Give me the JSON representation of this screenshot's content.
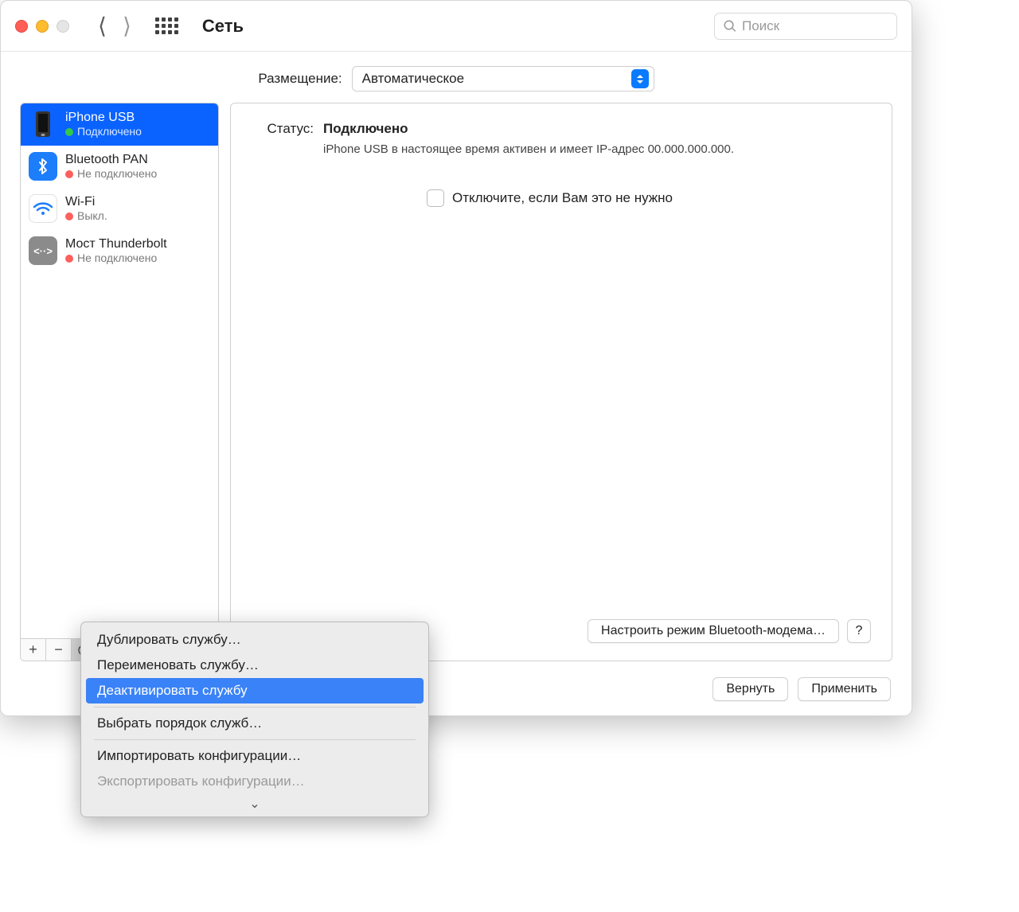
{
  "toolbar": {
    "title": "Сеть",
    "search_placeholder": "Поиск"
  },
  "location": {
    "label": "Размещение:",
    "value": "Автоматическое"
  },
  "sidebar": {
    "services": [
      {
        "name": "iPhone USB",
        "status": "Подключено",
        "dot": "green",
        "icon": "phone",
        "selected": true
      },
      {
        "name": "Bluetooth PAN",
        "status": "Не подключено",
        "dot": "red",
        "icon": "bluetooth",
        "selected": false
      },
      {
        "name": "Wi-Fi",
        "status": "Выкл.",
        "dot": "red",
        "icon": "wifi",
        "selected": false
      },
      {
        "name": "Мост Thunderbolt",
        "status": "Не подключено",
        "dot": "red",
        "icon": "thunderbolt",
        "selected": false
      }
    ]
  },
  "detail": {
    "status_label": "Статус:",
    "status_value": "Подключено",
    "status_desc": "iPhone USB в настоящее время активен и имеет IP-адрес 00.000.000.000.",
    "checkbox_label": "Отключите, если Вам это не нужно",
    "advanced_button": "Настроить режим Bluetooth-модема…",
    "help": "?"
  },
  "footer": {
    "revert": "Вернуть",
    "apply": "Применить"
  },
  "menu": {
    "items": [
      {
        "label": "Дублировать службу…",
        "state": "normal"
      },
      {
        "label": "Переименовать службу…",
        "state": "normal"
      },
      {
        "label": "Деактивировать службу",
        "state": "highlighted"
      },
      {
        "sep": true
      },
      {
        "label": "Выбрать порядок служб…",
        "state": "normal"
      },
      {
        "sep": true
      },
      {
        "label": "Импортировать конфигурации…",
        "state": "normal"
      },
      {
        "label": "Экспортировать конфигурации…",
        "state": "disabled"
      }
    ]
  }
}
